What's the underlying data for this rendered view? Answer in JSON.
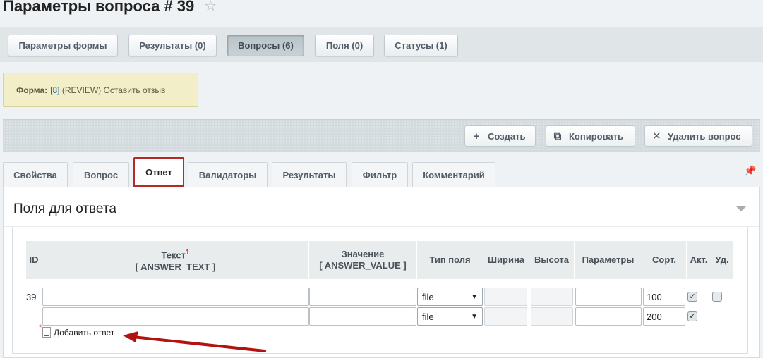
{
  "page": {
    "title": "Параметры вопроса # 39"
  },
  "icons": {
    "star": "star-icon",
    "pin": "pin-icon",
    "add": "plus-icon",
    "copy": "copy-icon",
    "delete": "close-icon"
  },
  "colors": {
    "accent_border": "#b42a25",
    "info_bg": "#f1eec8",
    "link": "#2067b0"
  },
  "top_tabs": [
    {
      "label": "Параметры формы",
      "active": false
    },
    {
      "label": "Результаты (0)",
      "active": false
    },
    {
      "label": "Вопросы (6)",
      "active": true
    },
    {
      "label": "Поля (0)",
      "active": false
    },
    {
      "label": "Статусы (1)",
      "active": false
    }
  ],
  "form_info": {
    "label": "Форма:",
    "link": "[8]",
    "text": "(REVIEW) Оставить отзыв"
  },
  "actions": {
    "create": "Создать",
    "copy": "Копировать",
    "delete": "Удалить вопрос"
  },
  "tabs": [
    {
      "label": "Свойства",
      "active": false
    },
    {
      "label": "Вопрос",
      "active": false
    },
    {
      "label": "Ответ",
      "active": true
    },
    {
      "label": "Валидаторы",
      "active": false
    },
    {
      "label": "Результаты",
      "active": false
    },
    {
      "label": "Фильтр",
      "active": false
    },
    {
      "label": "Комментарий",
      "active": false
    }
  ],
  "section": {
    "title": "Поля для ответа"
  },
  "table": {
    "headers": {
      "id": "ID",
      "text": "Текст",
      "text_sup": "1",
      "text_code": "[ ANSWER_TEXT ]",
      "value": "Значение",
      "value_code": "[ ANSWER_VALUE ]",
      "type": "Тип поля",
      "width": "Ширина",
      "height": "Высота",
      "params": "Параметры",
      "sort": "Сорт.",
      "active": "Акт.",
      "del": "Уд."
    },
    "rows": [
      {
        "id": "39",
        "text": "",
        "value": "",
        "type": "file",
        "width": "",
        "height": "",
        "params": "",
        "sort": "100",
        "active": true,
        "del": false
      },
      {
        "id": "",
        "text": "",
        "value": "",
        "type": "file",
        "width": "",
        "height": "",
        "params": "",
        "sort": "200",
        "active": true
      }
    ]
  },
  "add_answer": {
    "label": "Добавить ответ"
  }
}
